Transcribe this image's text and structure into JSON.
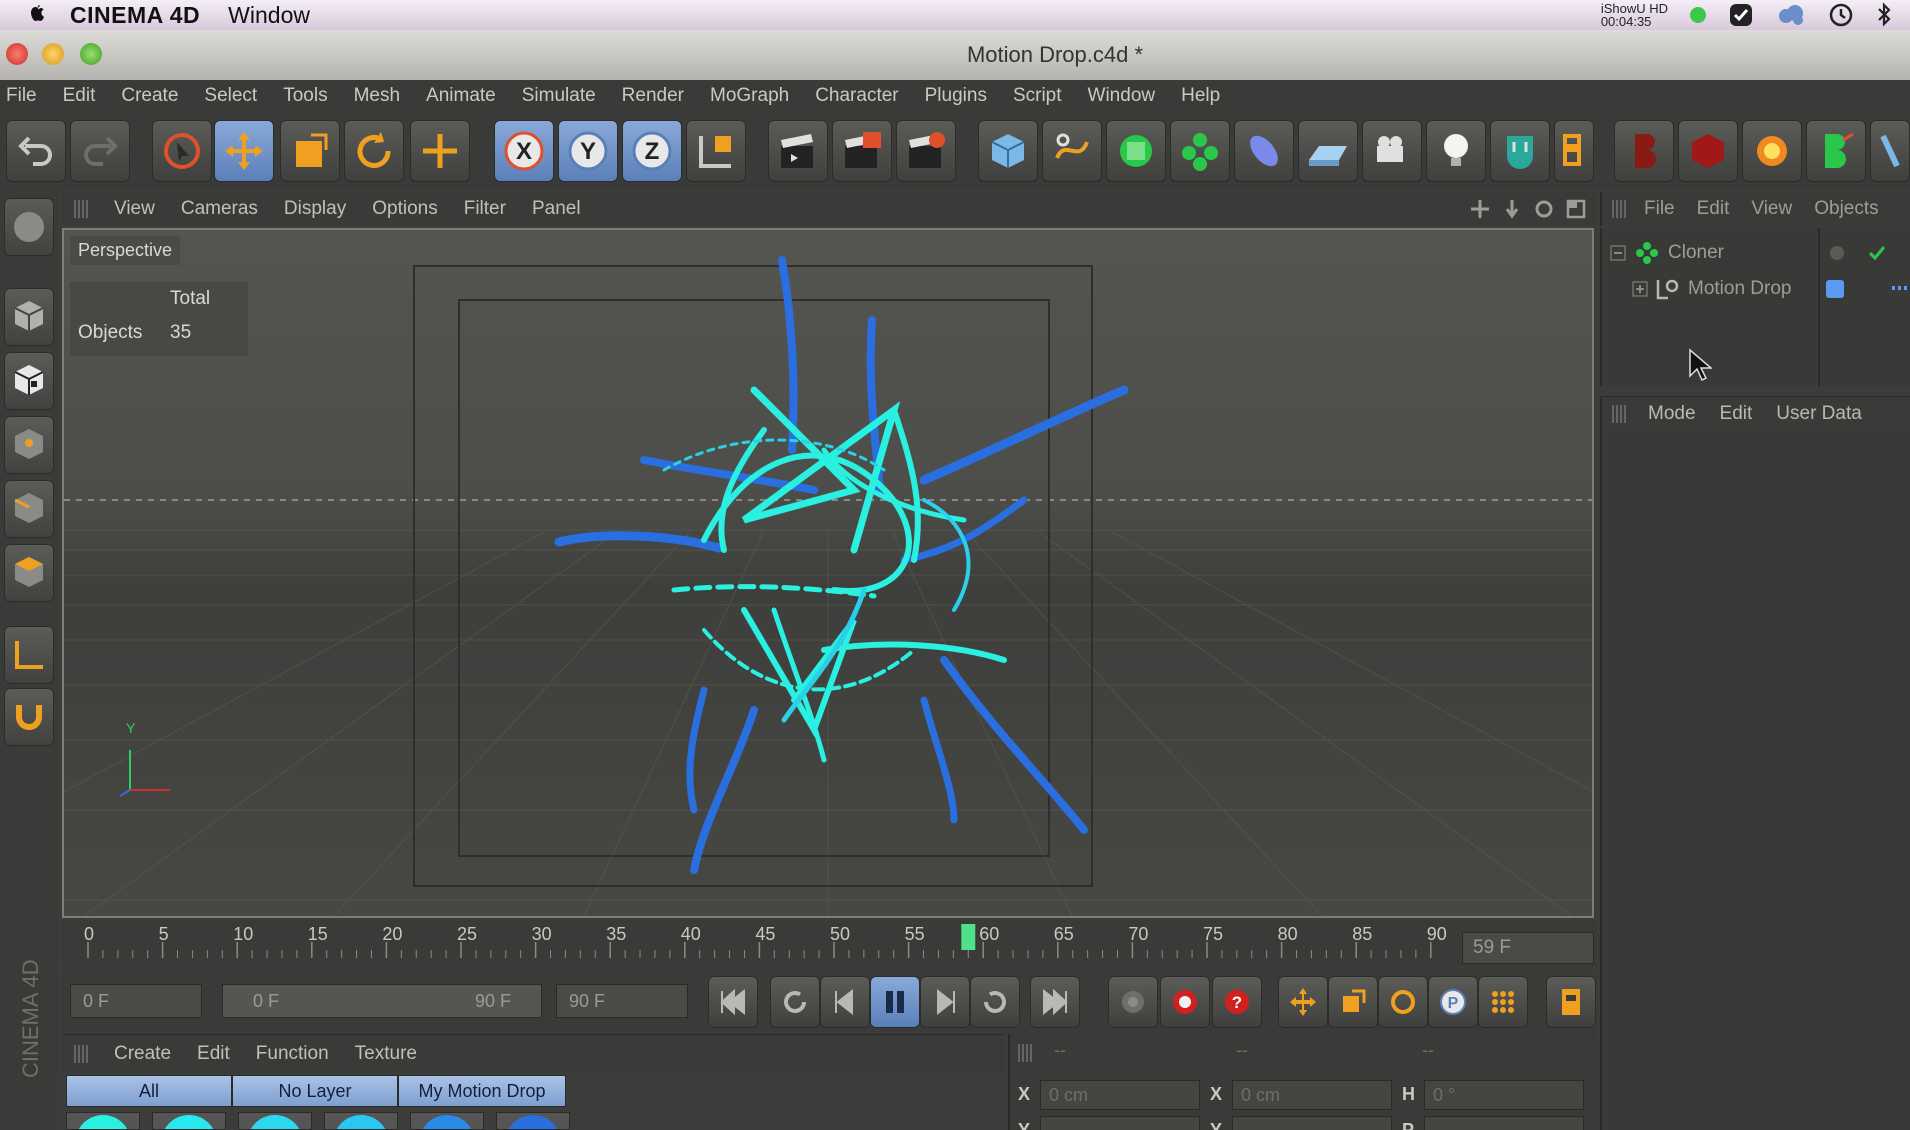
{
  "os_menubar": {
    "app_name": "CINEMA 4D",
    "menu_window": "Window",
    "recorder_label": "iShowU HD",
    "recorder_time": "00:04:35"
  },
  "window": {
    "title": "Motion Drop.c4d *"
  },
  "main_menu": [
    "File",
    "Edit",
    "Create",
    "Select",
    "Tools",
    "Mesh",
    "Animate",
    "Simulate",
    "Render",
    "MoGraph",
    "Character",
    "Plugins",
    "Script",
    "Window",
    "Help"
  ],
  "viewport": {
    "menu": [
      "View",
      "Cameras",
      "Display",
      "Options",
      "Filter",
      "Panel"
    ],
    "camera_label": "Perspective",
    "stats_header": "Total",
    "stats_label": "Objects",
    "stats_value": "35",
    "axis_y": "Y"
  },
  "timeline": {
    "ticks": [
      "0",
      "5",
      "10",
      "15",
      "20",
      "25",
      "30",
      "35",
      "40",
      "45",
      "50",
      "55",
      "60",
      "65",
      "70",
      "75",
      "80",
      "85",
      "90"
    ],
    "current_frame_display": "59 F",
    "playhead_frame": 59
  },
  "playback": {
    "start_frame": "0 F",
    "range_start": "0 F",
    "range_end": "90 F",
    "end_frame": "90 F"
  },
  "material_manager": {
    "menu": [
      "Create",
      "Edit",
      "Function",
      "Texture"
    ],
    "tabs": [
      "All",
      "No Layer",
      "My Motion Drop"
    ]
  },
  "coordinates": {
    "fields": [
      {
        "label": "X",
        "value": "0 cm"
      },
      {
        "label": "X",
        "value": "0 cm"
      },
      {
        "label": "H",
        "value": "0 °"
      }
    ],
    "row2_labels": [
      "Y",
      "Y",
      "P"
    ],
    "header_dashes": [
      "--",
      "--",
      "--"
    ]
  },
  "object_manager": {
    "menu": [
      "File",
      "Edit",
      "View",
      "Objects"
    ],
    "objects": [
      {
        "name": "Cloner",
        "indent": 0
      },
      {
        "name": "Motion Drop",
        "indent": 1
      }
    ]
  },
  "attribute_manager": {
    "menu": [
      "Mode",
      "Edit",
      "User Data"
    ]
  },
  "side_label": "CINEMA 4D",
  "colors": {
    "panel_bg": "#3a3b38",
    "selected_tool": "#7f9fcf",
    "strands_cyan": "#29f0e0",
    "strands_blue": "#2a6fe0",
    "playhead": "#4fe08a"
  }
}
